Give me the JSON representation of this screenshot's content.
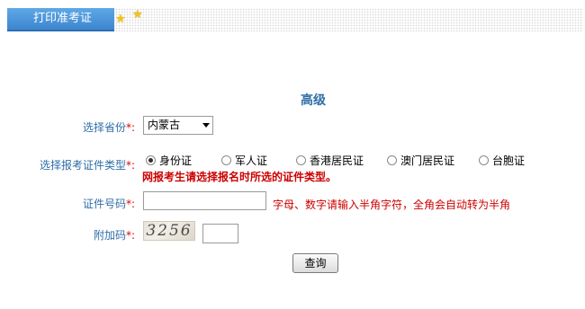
{
  "header": {
    "tab_label": "打印准考证"
  },
  "form": {
    "title": "高级",
    "province": {
      "label": "选择省份",
      "required_mark": "*:",
      "value": "内蒙古"
    },
    "cert_type": {
      "label": "选择报考证件类型",
      "required_mark": "*:",
      "options": [
        "身份证",
        "军人证",
        "香港居民证",
        "澳门居民证",
        "台胞证"
      ],
      "selected": "身份证",
      "note": "网报考生请选择报名时所选的证件类型。"
    },
    "cert_number": {
      "label": "证件号码",
      "required_mark": "*:",
      "value": "",
      "hint": "字母、数字请输入半角字符，全角会自动转为半角"
    },
    "captcha": {
      "label": "附加码",
      "required_mark": "*:",
      "image_text": "3256",
      "value": ""
    },
    "submit_label": "查询"
  },
  "colors": {
    "label": "#2f6ea8",
    "required": "#e00000",
    "note": "#cc0000",
    "tab": "#3d86cf"
  }
}
